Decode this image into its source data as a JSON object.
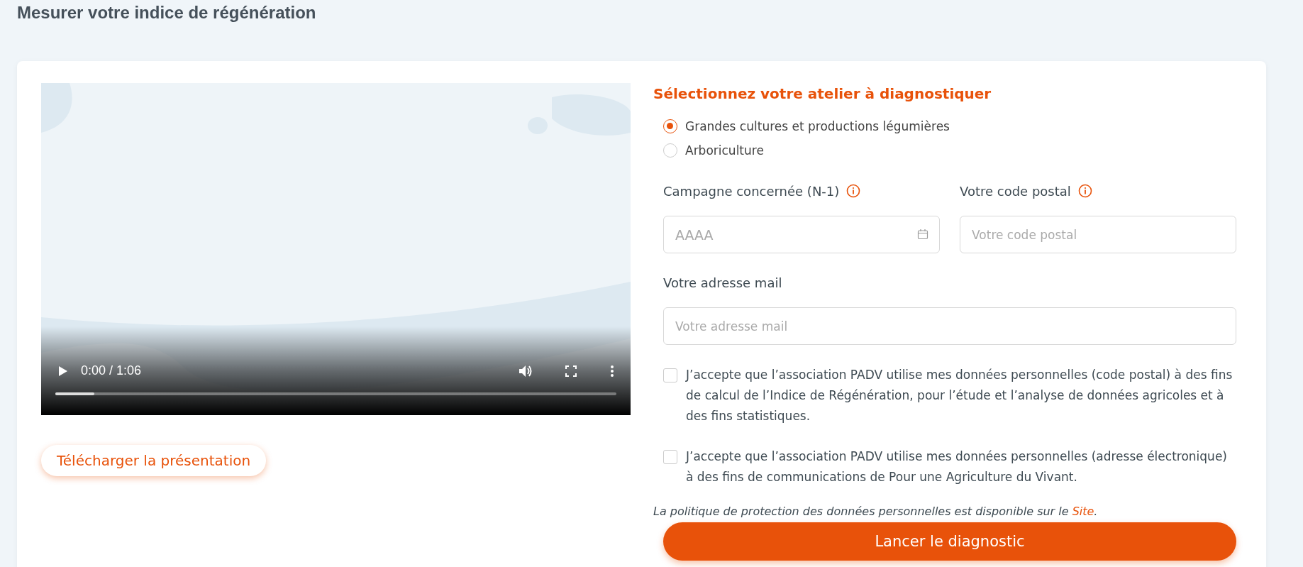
{
  "page": {
    "title": "Mesurer votre indice de régénération"
  },
  "video": {
    "kind": "picture",
    "time": "0:00 / 1:06",
    "level": 0.07
  },
  "download_button": "Télécharger la présentation",
  "form": {
    "heading": "Sélectionnez votre atelier à diagnostiquer",
    "options": [
      {
        "label": "Grandes cultures et productions légumières",
        "selected": true
      },
      {
        "label": "Arboriculture",
        "selected": false
      }
    ],
    "fields": [
      {
        "label": "Campagne concernée (N-1)",
        "placeholder": "AAAA",
        "info": true,
        "calendar": true
      },
      {
        "label": "Votre code postal",
        "placeholder": "Votre code postal",
        "info": true,
        "calendar": false
      },
      {
        "label": "Votre adresse mail",
        "placeholder": "Votre adresse mail",
        "info": false,
        "calendar": false
      }
    ],
    "consents": [
      {
        "text": "J’accepte que l’association PADV utilise mes données personnelles (code postal) à des fins de calcul de l’Indice de Régénération, pour l’étude et l’analyse de données agricoles et à des fins statistiques.",
        "checked": false
      },
      {
        "text": "J’accepte que l’association PADV utilise mes données personnelles (adresse électronique) à des fins de communications de Pour une Agriculture du Vivant.",
        "checked": false
      }
    ],
    "privacy_text": "La politique de protection des données personnelles est disponible sur le",
    "privacy_link": "Site",
    "privacy_end": ".",
    "submit": "Lancer le diagnostic"
  }
}
